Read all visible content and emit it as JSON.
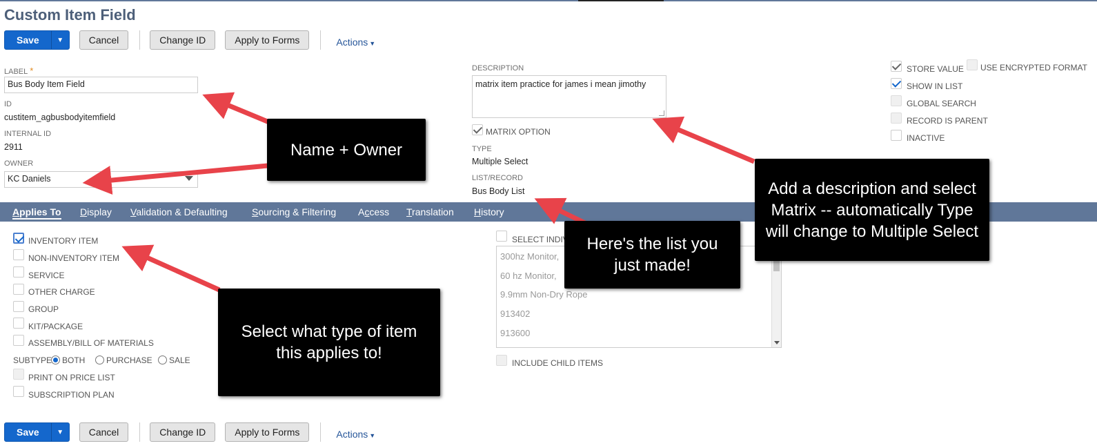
{
  "page": {
    "title": "Custom Item Field"
  },
  "toolbar": {
    "save_label": "Save",
    "cancel_label": "Cancel",
    "change_id_label": "Change ID",
    "apply_to_forms_label": "Apply to Forms",
    "actions_label": "Actions"
  },
  "fields": {
    "label": {
      "label": "LABEL",
      "required": "*",
      "value": "Bus Body Item Field"
    },
    "id": {
      "label": "ID",
      "value": "custitem_agbusbodyitemfield"
    },
    "internal_id": {
      "label": "INTERNAL ID",
      "value": "2911"
    },
    "owner": {
      "label": "OWNER",
      "value": "KC Daniels"
    },
    "description": {
      "label": "DESCRIPTION",
      "value": "matrix item practice for james i mean jimothy"
    },
    "matrix_option": {
      "label": "MATRIX OPTION",
      "checked": true
    },
    "type": {
      "label": "TYPE",
      "value": "Multiple Select"
    },
    "list_record": {
      "label": "LIST/RECORD",
      "value": "Bus Body List"
    }
  },
  "options": {
    "store_value": {
      "label": "STORE VALUE",
      "checked": true
    },
    "use_encrypted": {
      "label": "USE ENCRYPTED FORMAT",
      "checked": false
    },
    "show_in_list": {
      "label": "SHOW IN LIST",
      "checked": true
    },
    "global_search": {
      "label": "GLOBAL SEARCH",
      "checked": false
    },
    "record_is_parent": {
      "label": "RECORD IS PARENT",
      "checked": false
    },
    "inactive": {
      "label": "INACTIVE",
      "checked": false
    }
  },
  "tabs": [
    {
      "key": "A",
      "rest": "pplies To",
      "active": true
    },
    {
      "key": "D",
      "rest": "isplay",
      "active": false
    },
    {
      "key": "V",
      "rest": "alidation & Defaulting",
      "active": false
    },
    {
      "key": "S",
      "rest": "ourcing & Filtering",
      "active": false
    },
    {
      "key": "Ac",
      "pre": "A",
      "mid": "c",
      "rest": "cess",
      "active": false
    },
    {
      "key": "T",
      "rest": "ranslation",
      "active": false
    },
    {
      "key": "H",
      "rest": "istory",
      "active": false
    }
  ],
  "applies_to": {
    "items": [
      {
        "label": "INVENTORY ITEM",
        "checked": true
      },
      {
        "label": "NON-INVENTORY ITEM",
        "checked": false
      },
      {
        "label": "SERVICE",
        "checked": false
      },
      {
        "label": "OTHER CHARGE",
        "checked": false
      },
      {
        "label": "GROUP",
        "checked": false
      },
      {
        "label": "KIT/PACKAGE",
        "checked": false
      },
      {
        "label": "ASSEMBLY/BILL OF MATERIALS",
        "checked": false
      }
    ],
    "subtype_label": "SUBTYPE",
    "subtype_options": [
      "BOTH",
      "PURCHASE",
      "SALE"
    ],
    "subtype_selected": "BOTH",
    "print_on_price_list": "PRINT ON PRICE LIST",
    "subscription_plan": "SUBSCRIPTION PLAN",
    "select_individual": "SELECT INDIVI",
    "list_items": [
      "300hz Monitor,",
      "60 hz Monitor,",
      "9.9mm Non-Dry Rope",
      "913402",
      "913600"
    ],
    "include_child_items": "INCLUDE CHILD ITEMS"
  },
  "callouts": {
    "name_owner": "Name + Owner",
    "description": "Add a description and select Matrix -- automatically Type will change to Multiple Select",
    "list": "Here's the list you just made!",
    "item_type": "Select what type of item this applies to!"
  },
  "colors": {
    "brand_blue": "#1467cc",
    "tab_bar": "#607799",
    "title": "#4d5f79",
    "arrow": "#e8434a"
  }
}
